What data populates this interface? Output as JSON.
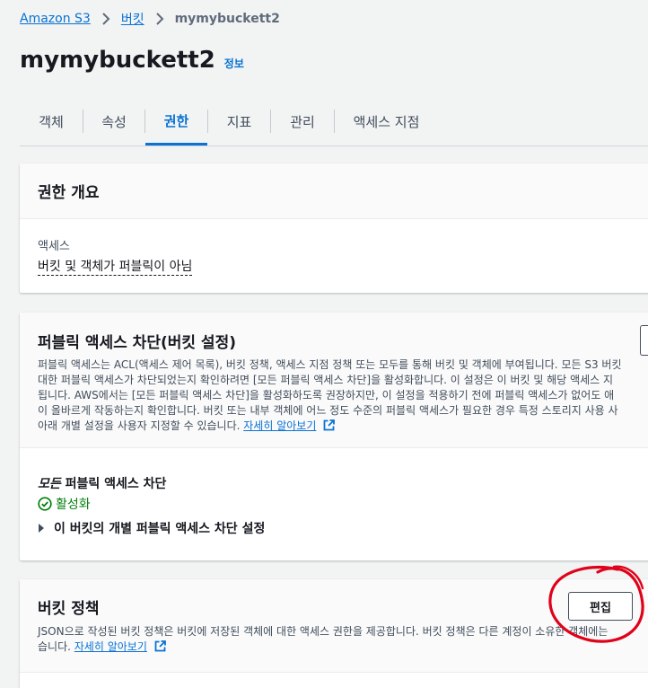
{
  "breadcrumb": {
    "items": [
      "Amazon S3",
      "버킷"
    ],
    "current": "mymybuckett2"
  },
  "header": {
    "title": "mymybuckett2",
    "info_label": "정보"
  },
  "tabs": [
    {
      "label": "객체"
    },
    {
      "label": "속성"
    },
    {
      "label": "권한",
      "active": true
    },
    {
      "label": "지표"
    },
    {
      "label": "관리"
    },
    {
      "label": "액세스 지점"
    }
  ],
  "permissions_overview": {
    "heading": "권한 개요",
    "access_label": "액세스",
    "access_value": "버킷 및 객체가 퍼블릭이 아님"
  },
  "block_public_access": {
    "heading": "퍼블릭 액세스 차단(버킷 설정)",
    "description_lines": [
      "퍼블릭 액세스는 ACL(액세스 제어 목록), 버킷 정책, 액세스 지점 정책 또는 모두를 통해 버킷 및 객체에 부여됩니다. 모든 S3 버킷",
      "대한 퍼블릭 액세스가 차단되었는지 확인하려면 [모든 퍼블릭 액세스 차단]을 활성화합니다. 이 설정은 이 버킷 및 해당 액세스 지",
      "됩니다. AWS에서는 [모든 퍼블릭 액세스 차단]을 활성화하도록 권장하지만, 이 설정을 적용하기 전에 퍼블릭 액세스가 없어도 애",
      "이 올바르게 작동하는지 확인합니다. 버킷 또는 내부 객체에 어느 정도 수준의 퍼블릭 액세스가 필요한 경우 특정 스토리지 사용 사",
      "아래 개별 설정을 사용자 지정할 수 있습니다."
    ],
    "learn_more": "자세히 알아보기",
    "block_all_label_italic": "모든",
    "block_all_label_rest": " 퍼블릭 액세스 차단",
    "status": "활성화",
    "expand_label": "이 버킷의 개별 퍼블릭 액세스 차단 설정"
  },
  "bucket_policy": {
    "heading": "버킷 정책",
    "edit_label": "편집",
    "description_line1": "JSON으로 작성된 버킷 정책은 버킷에 저장된 객체에 대한 액세스 권한을 제공합니다. 버킷 정책은 다른 계정이 소유한 객체에는",
    "description_line2_prefix": "습니다.",
    "learn_more": "자세히 알아보기"
  },
  "colors": {
    "link": "#0972d3",
    "success": "#037f0c",
    "annotation": "#e0021a"
  }
}
